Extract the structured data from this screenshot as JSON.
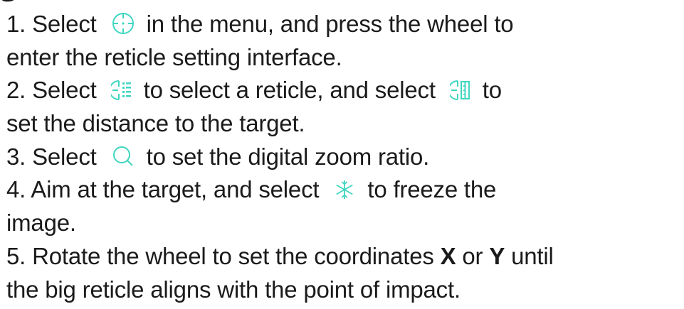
{
  "doc": {
    "heading_fragment": "S",
    "icons": {
      "crosshair": "crosshair-icon",
      "reticle_select": "reticle-select-icon",
      "reticle_distance": "reticle-distance-icon",
      "zoom": "magnifier-icon",
      "freeze": "snowflake-icon"
    },
    "accent_color": "#3fd6c0",
    "step1": {
      "a": "1. Select",
      "b": "in the menu, and press the wheel to",
      "c": "enter the reticle setting interface."
    },
    "step2": {
      "a": "2. Select",
      "b": "to select a reticle, and select",
      "c": "to",
      "d": "set the distance to the target."
    },
    "step3": {
      "a": "3. Select",
      "b": "to set the digital zoom ratio."
    },
    "step4": {
      "a": "4. Aim at the target, and select",
      "b": "to freeze the",
      "c": "image."
    },
    "step5": {
      "a": "5. Rotate the wheel to set the coordinates",
      "x": "X",
      "or": "or",
      "y": "Y",
      "until": "until",
      "c": "the big reticle aligns with the point of impact."
    }
  }
}
